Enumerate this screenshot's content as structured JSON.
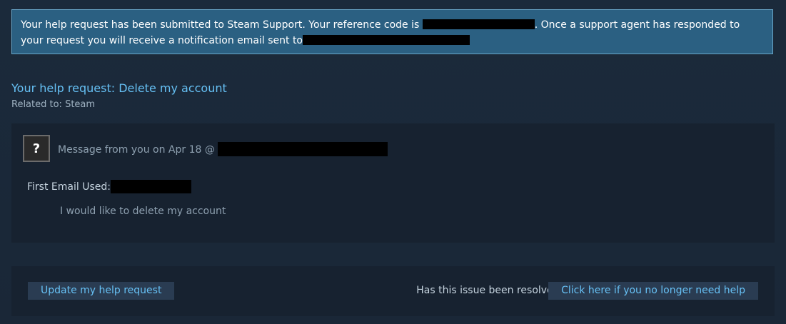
{
  "notice": {
    "text_part1": "Your help request has been submitted to Steam Support. Your reference code is ",
    "text_part2": ". Once a support agent has responded to your request you will receive a notification email sent to"
  },
  "request": {
    "title": "Your help request: Delete my account",
    "related": "Related to: Steam"
  },
  "message": {
    "avatar_glyph": "?",
    "header": "Message from you on Apr 18 @",
    "email_label": "First Email Used:",
    "body": "I would like to delete my account"
  },
  "actions": {
    "update_label": "Update my help request",
    "resolved_question": "Has this issue been resolved?",
    "no_longer_need_label": "Click here if you no longer need help"
  }
}
